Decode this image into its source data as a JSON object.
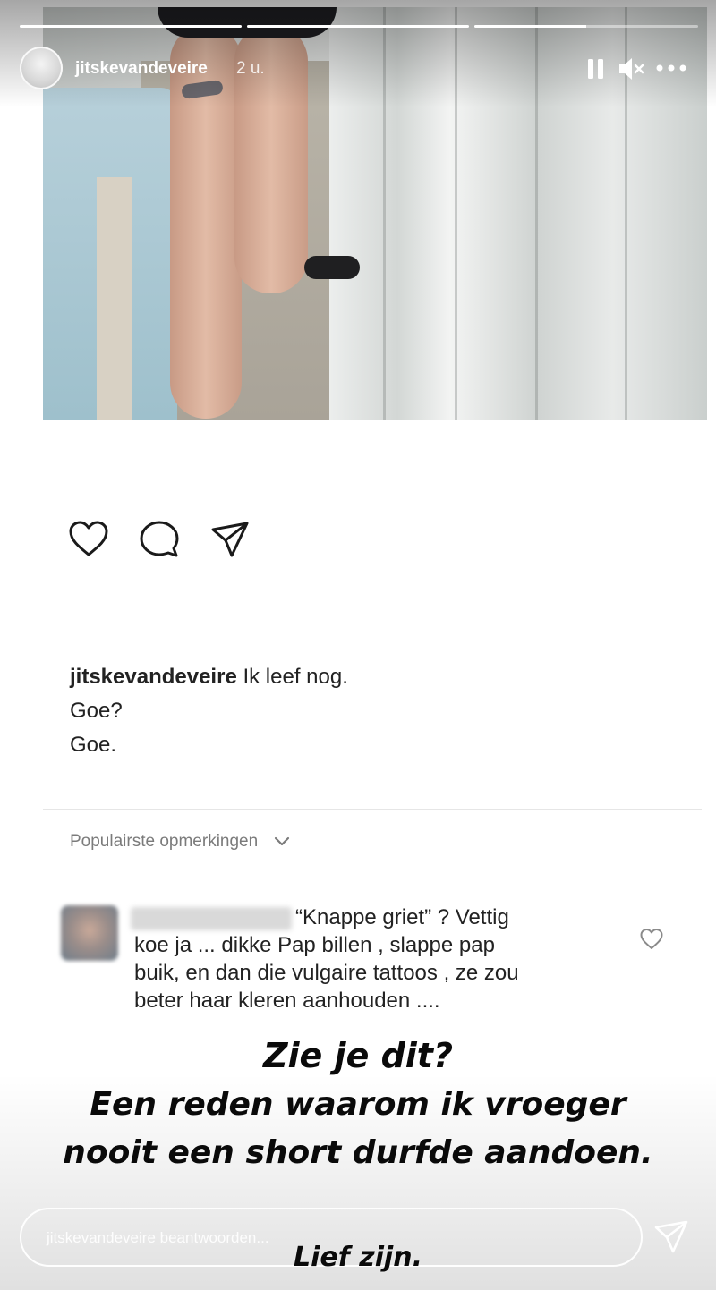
{
  "story": {
    "username": "jitskevandeveire",
    "time": "2 u.",
    "progress": [
      1.0,
      1.0,
      0.5
    ],
    "icons": [
      "pause-icon",
      "mute-icon",
      "more-icon"
    ]
  },
  "post": {
    "icons": [
      "heart-icon",
      "comment-icon",
      "share-icon"
    ],
    "caption_user": "jitskevandeveire",
    "caption_line1": "Ik leef nog.",
    "caption_line2": "Goe?",
    "caption_line3": "Goe.",
    "popular_label": "Populairste opmerkingen"
  },
  "comment": {
    "text_line1": "“Knappe griet” ? Vettig",
    "text_line2": "koe ja ... dikke Pap billen , slappe pap",
    "text_line3": "buik, en dan die vulgaire tattoos , ze zou",
    "text_line4": "beter haar kleren aanhouden ...."
  },
  "overlay": {
    "line1": "Zie je dit?",
    "line2": "Een reden waarom ik vroeger",
    "line3": "nooit een short durfde aandoen.",
    "line4": "Lief zijn."
  },
  "reply": {
    "placeholder": "jitskevandeveire beantwoorden..."
  }
}
